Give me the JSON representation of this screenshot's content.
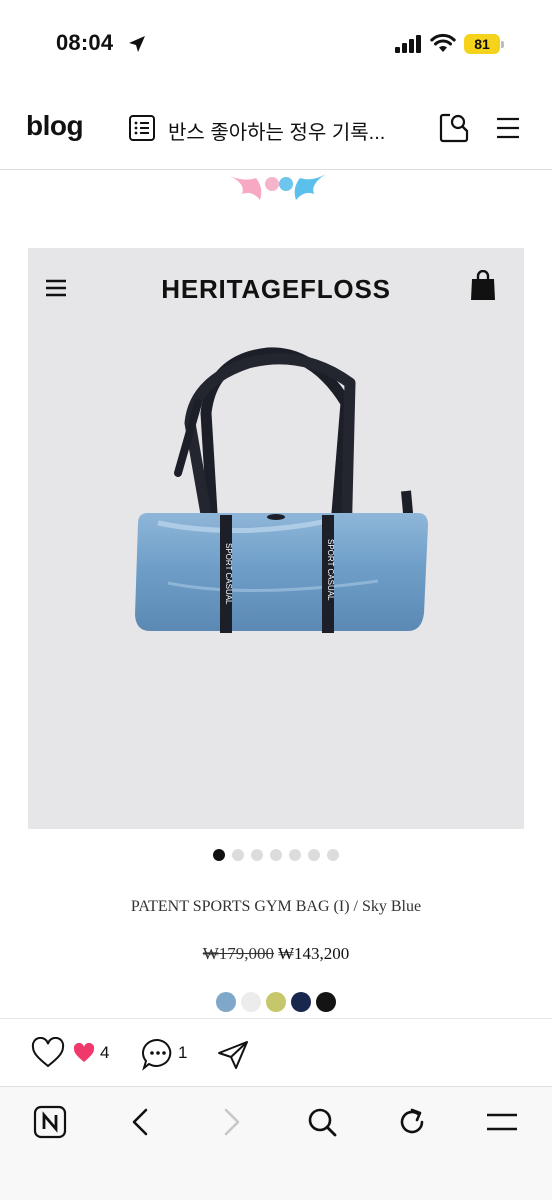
{
  "status_bar": {
    "time": "08:04",
    "battery": "81"
  },
  "header": {
    "logo": "blog",
    "title": "반스 좋아하는 정우 기록..."
  },
  "shop": {
    "brand": "HERITAGEFLOSS",
    "product_name": "PATENT SPORTS GYM BAG (I) / Sky Blue",
    "price_original": "₩179,000",
    "price_sale": "₩143,200",
    "strap_text": "SPORT CASUAL",
    "carousel_total": 7,
    "carousel_active": 1,
    "colors": [
      "#7ea7c9",
      "#ececec",
      "#c6c66a",
      "#18274d",
      "#141414"
    ]
  },
  "reactions": {
    "like_count": "4",
    "comment_count": "1"
  },
  "icons": [
    "location-arrow-icon",
    "signal-icon",
    "wifi-icon",
    "battery-icon",
    "list-icon",
    "search-icon",
    "menu-icon",
    "hamburger-icon",
    "shopping-bag-icon",
    "heart-icon",
    "comment-icon",
    "share-icon",
    "naver-icon",
    "back-icon",
    "forward-icon",
    "refresh-icon"
  ]
}
